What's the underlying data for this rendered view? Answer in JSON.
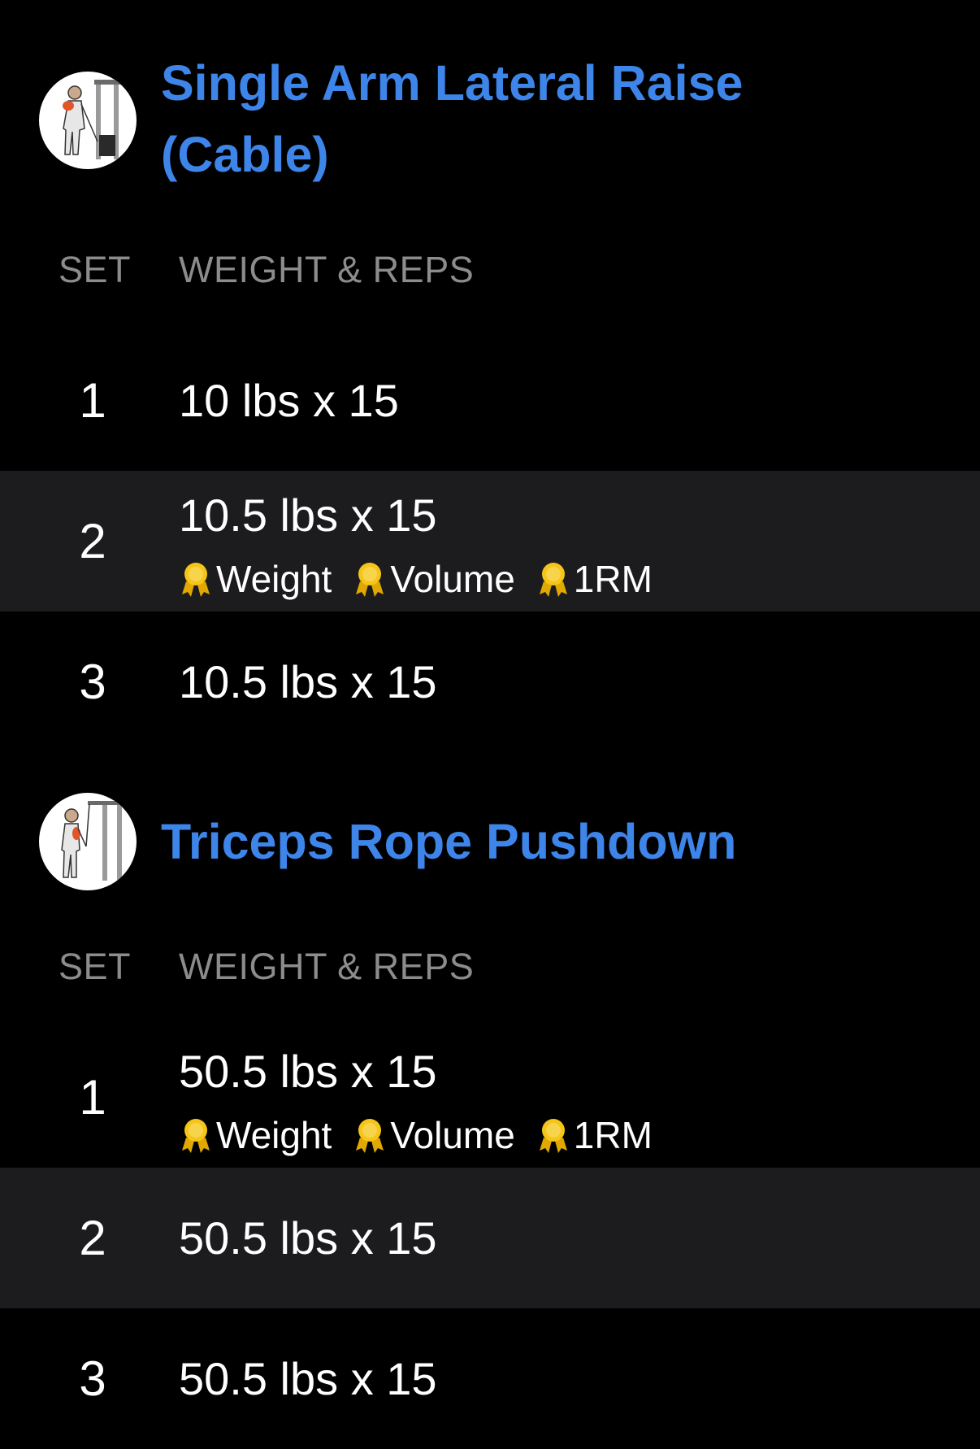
{
  "exercises": [
    {
      "title": "Single Arm Lateral Raise (Cable)",
      "col_set": "SET",
      "col_weight_reps": "WEIGHT & REPS",
      "sets": [
        {
          "num": "1",
          "value": "10 lbs x 15"
        },
        {
          "num": "2",
          "value": "10.5 lbs x 15",
          "prs": [
            "Weight",
            "Volume",
            "1RM"
          ]
        },
        {
          "num": "3",
          "value": "10.5 lbs x 15"
        }
      ]
    },
    {
      "title": "Triceps Rope Pushdown",
      "col_set": "SET",
      "col_weight_reps": "WEIGHT & REPS",
      "sets": [
        {
          "num": "1",
          "value": "50.5 lbs x 15",
          "prs": [
            "Weight",
            "Volume",
            "1RM"
          ]
        },
        {
          "num": "2",
          "value": "50.5 lbs x 15"
        },
        {
          "num": "3",
          "value": "50.5 lbs x 15"
        }
      ]
    }
  ],
  "colors": {
    "title": "#3e85ea",
    "header_text": "#8c8c8c",
    "alt_row": "#1c1c1e",
    "medal": "#f5c518"
  },
  "icons": {
    "thumbnail_1": "cable-lateral-raise-illustration",
    "thumbnail_2": "rope-pushdown-illustration",
    "pr_badge": "medal-icon"
  }
}
